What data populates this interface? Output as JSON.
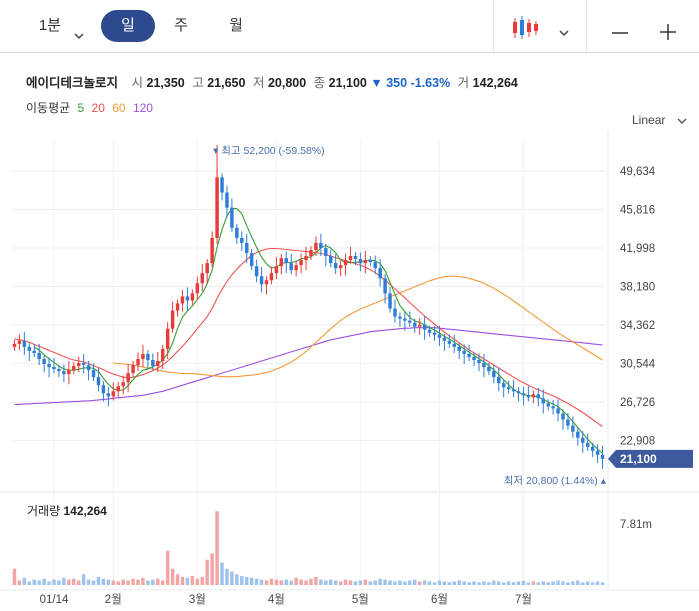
{
  "tabs": {
    "minute_label": "1분",
    "day_label": "일",
    "week_label": "주",
    "month_label": "월"
  },
  "info": {
    "name": "에이디테크놀로지",
    "open_label": "시",
    "open": "21,350",
    "high_label": "고",
    "high": "21,650",
    "low_label": "저",
    "low": "20,800",
    "close_label": "종",
    "close": "21,100",
    "change": "350",
    "change_pct": "-1.63%",
    "volume_label": "거",
    "volume": "142,264"
  },
  "moving_average": {
    "label": "이동평균",
    "periods": [
      "5",
      "20",
      "60",
      "120"
    ],
    "colors": [
      "#36a030",
      "#ef5350",
      "#f39a3c",
      "#9c4fe0"
    ]
  },
  "scale_label": "Linear",
  "colors": {
    "up": "#e83b3b",
    "down": "#2e7dd6",
    "accent": "#2e4a8f"
  },
  "chart_data": {
    "type": "candlestick",
    "x_ticks": [
      "01/14",
      "2월",
      "3월",
      "4월",
      "5월",
      "6월",
      "7월"
    ],
    "y_ticks": [
      49634,
      45816,
      41998,
      38180,
      34362,
      30544,
      26726,
      22908
    ],
    "ylim": [
      20000,
      52700
    ],
    "current_price_label": "21,100",
    "current_price": 21100,
    "high_annotation": "최고 52,200 (-59.58%)",
    "high_value": 52200,
    "low_annotation": "최저 20,800 (1.44%)",
    "low_value": 20800,
    "volume_label": "거래량",
    "volume_value": "142,264",
    "volume_axis_label": "7.81m",
    "volume_max": 7810000,
    "grid": true,
    "close_series": [
      32500,
      32800,
      32200,
      31800,
      31600,
      31000,
      30500,
      30200,
      30000,
      29800,
      29500,
      29900,
      30300,
      30600,
      30400,
      29900,
      29200,
      28400,
      27600,
      27300,
      27800,
      28300,
      28700,
      29600,
      30400,
      31000,
      31500,
      30900,
      30300,
      30800,
      32000,
      34000,
      35800,
      36500,
      37200,
      36800,
      37500,
      38500,
      39500,
      40500,
      43000,
      49000,
      47500,
      46000,
      44000,
      43000,
      42500,
      41500,
      40200,
      39200,
      38400,
      38800,
      39500,
      40200,
      41000,
      40500,
      39800,
      40300,
      40800,
      41200,
      41800,
      42500,
      42000,
      41200,
      40500,
      40000,
      40300,
      40800,
      41200,
      40900,
      40500,
      40800,
      40600,
      40000,
      39000,
      37500,
      36000,
      35200,
      35000,
      34800,
      34600,
      34200,
      34400,
      33900,
      33600,
      33400,
      33100,
      32800,
      32500,
      32200,
      31800,
      31500,
      31200,
      30900,
      30600,
      30200,
      29800,
      29200,
      28600,
      28200,
      28000,
      27800,
      27600,
      27400,
      27200,
      27500,
      27100,
      26600,
      26300,
      26100,
      25600,
      25000,
      24400,
      23800,
      23200,
      22700,
      22300,
      21900,
      21500,
      21100
    ],
    "ma5": [
      null,
      null,
      null,
      null,
      32180,
      31880,
      31420,
      31020,
      30660,
      30300,
      30000,
      29900,
      29880,
      29980,
      30120,
      30140,
      30080,
      29740,
      29100,
      28480,
      28040,
      27880,
      27940,
      28340,
      28960,
      29460,
      29880,
      30040,
      30220,
      30500,
      30900,
      31540,
      32580,
      34000,
      35140,
      35760,
      36280,
      36880,
      37520,
      38480,
      39800,
      42100,
      43800,
      45200,
      45900,
      45900,
      45400,
      44200,
      43100,
      42080,
      41100,
      40420,
      40020,
      40100,
      40460,
      40560,
      40560,
      40680,
      40920,
      41040,
      41120,
      41520,
      42020,
      42240,
      42000,
      41520,
      40800,
      40560,
      40560,
      40580,
      40600,
      40760,
      40800,
      40720,
      40440,
      39740,
      38600,
      37400,
      36300,
      35700,
      35120,
      34760,
      34640,
      34380,
      34100,
      33860,
      33580,
      33240,
      32980,
      32660,
      32340,
      32000,
      31680,
      31360,
      31040,
      30720,
      30340,
      29920,
      29440,
      28940,
      28440,
      28000,
      27680,
      27480,
      27360,
      27340,
      27240,
      27000,
      26740,
      26540,
      26260,
      25860,
      25360,
      24800,
      24200,
      23620,
      23060,
      22540,
      22080,
      21640
    ],
    "ma20": [
      33000,
      32900,
      32800,
      32650,
      32450,
      32250,
      32050,
      31850,
      31650,
      31450,
      31250,
      31050,
      30900,
      30800,
      30700,
      30550,
      30350,
      30150,
      29950,
      29700,
      29500,
      29350,
      29200,
      29150,
      29200,
      29300,
      29450,
      29650,
      29850,
      30100,
      30400,
      30800,
      31250,
      31750,
      32250,
      32800,
      33400,
      34000,
      34600,
      35200,
      36000,
      37000,
      37900,
      38700,
      39350,
      39900,
      40400,
      40850,
      41250,
      41550,
      41750,
      41900,
      41950,
      41950,
      41900,
      41850,
      41800,
      41750,
      41700,
      41650,
      41600,
      41550,
      41450,
      41350,
      41200,
      41050,
      40900,
      40750,
      40600,
      40450,
      40300,
      40100,
      39850,
      39550,
      39200,
      38800,
      38400,
      37950,
      37500,
      37050,
      36600,
      36150,
      35700,
      35250,
      34850,
      34450,
      34050,
      33650,
      33300,
      32950,
      32600,
      32250,
      31900,
      31600,
      31300,
      31000,
      30700,
      30400,
      30100,
      29800,
      29500,
      29200,
      28900,
      28650,
      28400,
      28150,
      27950,
      27750,
      27550,
      27350,
      27100,
      26850,
      26600,
      26300,
      26000,
      25700,
      25350,
      25000,
      24650,
      24300
    ],
    "ma60": [
      30600,
      30550,
      30500,
      30450,
      30400,
      30300,
      30200,
      30100,
      30000,
      29900,
      29800,
      29700,
      29650,
      29600,
      29550,
      29550,
      29550,
      29500,
      29450,
      29400,
      29350,
      29300,
      29250,
      29250,
      29250,
      29250,
      29300,
      29350,
      29400,
      29450,
      29550,
      29650,
      29800,
      30000,
      30200,
      30450,
      30700,
      31000,
      31350,
      31750,
      32200,
      32650,
      33100,
      33550,
      34000,
      34400,
      34800,
      35150,
      35450,
      35700,
      35950,
      36150,
      36350,
      36550,
      36750,
      36950,
      37150,
      37350,
      37550,
      37750,
      37950,
      38150,
      38350,
      38550,
      38750,
      38900,
      39050,
      39150,
      39200,
      39200,
      39150,
      39100,
      39000,
      38850,
      38700,
      38500,
      38250,
      38000,
      37700,
      37400,
      37100,
      36750,
      36400,
      36050,
      35700,
      35350,
      35000,
      34650,
      34300,
      33950,
      33600,
      33300,
      33000,
      32700,
      32400,
      32100,
      31800,
      31500,
      31200,
      30900
    ],
    "ma120": [
      26500,
      26500,
      26550,
      26550,
      26600,
      26600,
      26650,
      26650,
      26700,
      26700,
      26750,
      26750,
      26800,
      26800,
      26850,
      26850,
      26900,
      26950,
      27000,
      27050,
      27100,
      27150,
      27200,
      27250,
      27300,
      27350,
      27400,
      27500,
      27600,
      27700,
      27800,
      27950,
      28100,
      28250,
      28400,
      28550,
      28700,
      28850,
      29000,
      29150,
      29300,
      29450,
      29600,
      29750,
      29900,
      30050,
      30200,
      30350,
      30500,
      30650,
      30800,
      30950,
      31100,
      31250,
      31400,
      31550,
      31700,
      31850,
      32000,
      32150,
      32300,
      32450,
      32600,
      32750,
      32900,
      33000,
      33100,
      33200,
      33300,
      33400,
      33500,
      33600,
      33700,
      33750,
      33800,
      33850,
      33900,
      33950,
      34000,
      34050,
      34050,
      34100,
      34100,
      34100,
      34100,
      34100,
      34050,
      34000,
      33950,
      33900,
      33850,
      33800,
      33750,
      33700,
      33650,
      33600,
      33550,
      33500,
      33450,
      33400,
      33350,
      33300,
      33250,
      33200,
      33150,
      33100,
      33050,
      33000,
      32950,
      32900,
      32850,
      32800,
      32750,
      32700,
      32650,
      32600,
      32550,
      32500,
      32450,
      32400
    ],
    "volume_series": [
      0.18,
      0.05,
      0.08,
      0.04,
      0.06,
      0.05,
      0.07,
      0.04,
      0.06,
      0.05,
      0.08,
      0.06,
      0.07,
      0.05,
      0.12,
      0.06,
      0.05,
      0.09,
      0.07,
      0.06,
      0.05,
      0.04,
      0.06,
      0.05,
      0.07,
      0.06,
      0.08,
      0.05,
      0.06,
      0.07,
      0.05,
      0.38,
      0.18,
      0.12,
      0.09,
      0.08,
      0.1,
      0.07,
      0.09,
      0.28,
      0.35,
      0.82,
      0.25,
      0.18,
      0.15,
      0.12,
      0.1,
      0.09,
      0.08,
      0.07,
      0.06,
      0.05,
      0.07,
      0.06,
      0.05,
      0.06,
      0.05,
      0.08,
      0.06,
      0.05,
      0.07,
      0.09,
      0.06,
      0.05,
      0.06,
      0.05,
      0.04,
      0.06,
      0.05,
      0.04,
      0.05,
      0.06,
      0.04,
      0.05,
      0.07,
      0.06,
      0.05,
      0.04,
      0.05,
      0.04,
      0.05,
      0.06,
      0.04,
      0.05,
      0.04,
      0.03,
      0.05,
      0.04,
      0.03,
      0.04,
      0.05,
      0.04,
      0.03,
      0.04,
      0.03,
      0.04,
      0.03,
      0.05,
      0.04,
      0.03,
      0.04,
      0.03,
      0.04,
      0.05,
      0.03,
      0.04,
      0.03,
      0.04,
      0.03,
      0.04,
      0.05,
      0.04,
      0.03,
      0.04,
      0.05,
      0.03,
      0.04,
      0.03,
      0.04,
      0.03
    ]
  }
}
